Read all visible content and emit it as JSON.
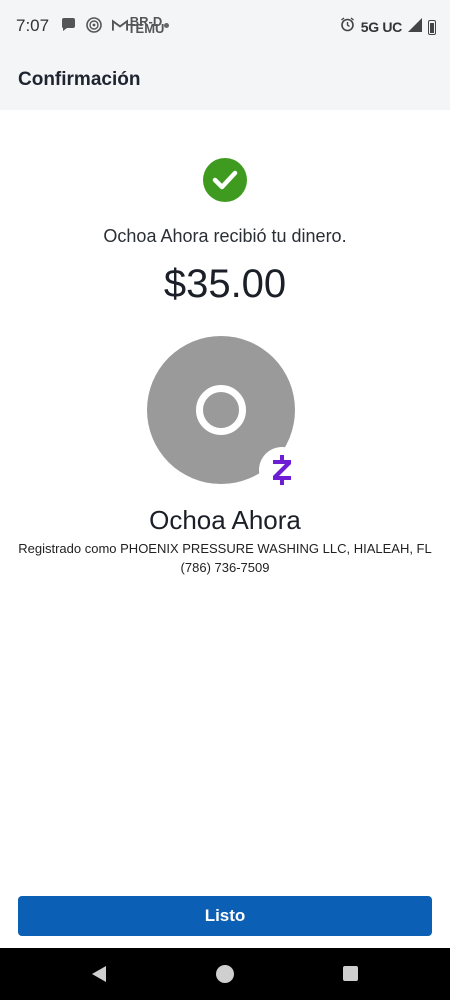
{
  "status_bar": {
    "time": "7:07",
    "temu_label_top": "BR-D",
    "temu_label_bottom": "TEMU",
    "network": "5G UC",
    "icons": [
      "chat-bubble-icon",
      "fingerprint-icon",
      "gmail-icon",
      "temu-icon",
      "dot-icon",
      "alarm-icon",
      "signal-icon",
      "battery-icon"
    ]
  },
  "header": {
    "title": "Confirmación"
  },
  "confirmation": {
    "message": "Ochoa Ahora recibió tu dinero.",
    "amount": "$35.00",
    "recipient_name": "Ochoa Ahora",
    "registered_as": "Registrado como PHOENIX PRESSURE WASHING LLC, HIALEAH, FL",
    "phone": "(786) 736-7509"
  },
  "button": {
    "done_label": "Listo"
  },
  "colors": {
    "success_green": "#3f9b1f",
    "primary_blue": "#0b5fb4",
    "zelle_purple": "#6d1ed4",
    "avatar_gray": "#9a9a9a"
  }
}
